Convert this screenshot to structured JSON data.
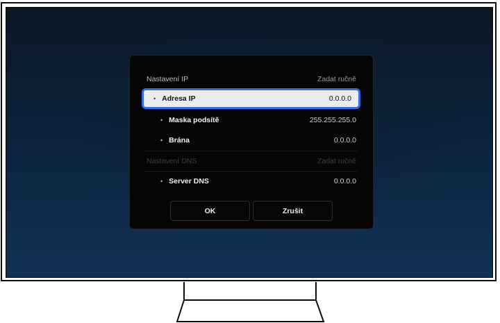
{
  "dialog": {
    "ip_settings": {
      "label": "Nastavení IP",
      "value": "Zadat ručně"
    },
    "ip_address": {
      "label": "Adresa IP",
      "value": "0.0.0.0"
    },
    "subnet_mask": {
      "label": "Maska podsítě",
      "value": "255.255.255.0"
    },
    "gateway": {
      "label": "Brána",
      "value": "0.0.0.0"
    },
    "dns_settings": {
      "label": "Nastavení DNS",
      "value": "Zadat ručně"
    },
    "dns_server": {
      "label": "Server DNS",
      "value": "0.0.0.0"
    },
    "bullet": "•",
    "ok_label": "OK",
    "cancel_label": "Zrušit"
  },
  "colors": {
    "focus_border": "#2f6ee4",
    "dialog_bg": "#050506",
    "screen_bg": "#0d2540"
  }
}
